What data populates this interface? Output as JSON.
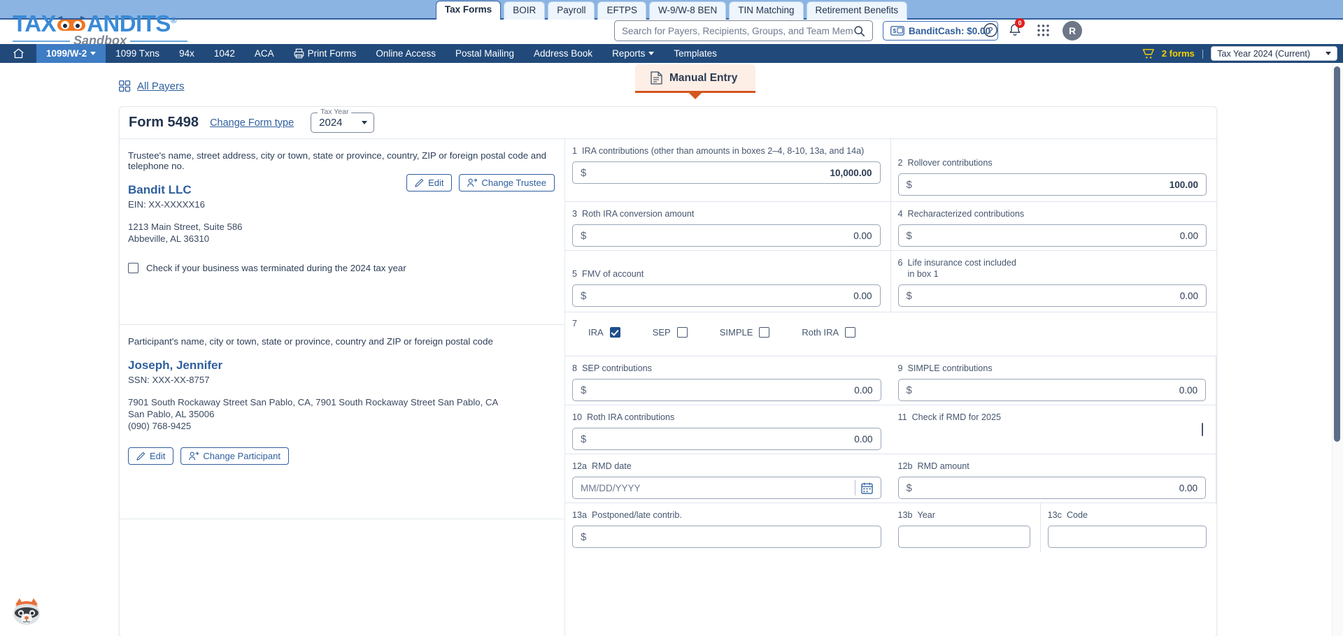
{
  "product_tabs": [
    {
      "label": "Tax Forms",
      "active": true
    },
    {
      "label": "BOIR",
      "active": false
    },
    {
      "label": "Payroll",
      "active": false
    },
    {
      "label": "EFTPS",
      "active": false
    },
    {
      "label": "W-9/W-8 BEN",
      "active": false
    },
    {
      "label": "TIN Matching",
      "active": false
    },
    {
      "label": "Retirement Benefits",
      "active": false
    }
  ],
  "brand": {
    "name_part1": "TAX",
    "name_part2": "ANDITS",
    "registered": "®",
    "subtitle": "Sandbox"
  },
  "search": {
    "placeholder": "Search for Payers, Recipients, Groups, and Team Members",
    "value": "",
    "icon": "search-icon"
  },
  "header": {
    "banditcash_label": "BanditCash: $0.00",
    "banditcash_icon": "cash-card-icon",
    "help_icon": "help-circle-icon",
    "bell_icon": "bell-icon",
    "notification_count": "0",
    "apps_icon": "apps-grid-icon",
    "avatar_initial": "R"
  },
  "nav": {
    "home_icon": "home-icon",
    "items": [
      {
        "label": "1099/W-2",
        "active": true,
        "caret": true
      },
      {
        "label": "1099 Txns",
        "active": false,
        "caret": false
      },
      {
        "label": "94x",
        "active": false,
        "caret": false
      },
      {
        "label": "1042",
        "active": false,
        "caret": false
      },
      {
        "label": "ACA",
        "active": false,
        "caret": false
      },
      {
        "label": "Print Forms",
        "active": false,
        "caret": false,
        "icon": "printer-icon"
      },
      {
        "label": "Online Access",
        "active": false,
        "caret": false
      },
      {
        "label": "Postal Mailing",
        "active": false,
        "caret": false
      },
      {
        "label": "Address Book",
        "active": false,
        "caret": false
      },
      {
        "label": "Reports",
        "active": false,
        "caret": true
      },
      {
        "label": "Templates",
        "active": false,
        "caret": false
      }
    ],
    "cart_icon": "cart-icon",
    "forms_count_label": "2 forms",
    "separator": "|",
    "tax_year_selected": "Tax Year 2024 (Current)"
  },
  "breadcrumb": {
    "all_payers_label": "All Payers",
    "grid_icon": "grid-squares-icon"
  },
  "entry_tab": {
    "label": "Manual Entry",
    "icon": "document-icon"
  },
  "form": {
    "title": "Form 5498",
    "change_form_link": "Change Form type",
    "tax_year_legend": "Tax Year",
    "tax_year_value": "2024"
  },
  "trustee": {
    "caption": "Trustee's name, street address, city or town, state or province, country, ZIP or foreign postal code and telephone no.",
    "name": "Bandit LLC",
    "ein": "EIN: XX-XXXXX16",
    "address_line1": "1213 Main Street, Suite 586",
    "address_line2": "Abbeville, AL 36310",
    "edit_label": "Edit",
    "edit_icon": "pencil-icon",
    "change_label": "Change Trustee",
    "change_icon": "user-switch-icon",
    "terminated_checkbox_label": "Check if your business was terminated during the 2024 tax year",
    "terminated_checked": false
  },
  "participant": {
    "caption": "Participant's name, city or town, state or province, country and ZIP or foreign postal code",
    "name": "Joseph, Jennifer",
    "ssn": "SSN: XXX-XX-8757",
    "address_line1": "7901 South Rockaway Street San Pablo, CA, 7901 South Rockaway Street San Pablo, CA",
    "address_line2": "San Pablo, AL 35006",
    "phone": "(090) 768-9425",
    "edit_label": "Edit",
    "edit_icon": "pencil-icon",
    "change_label": "Change Participant",
    "change_icon": "user-switch-icon"
  },
  "boxes": {
    "b1": {
      "num": "1",
      "label": "IRA contributions (other than amounts in boxes 2–4, 8-10, 13a, and 14a)",
      "currency": "$",
      "value": "10,000.00"
    },
    "b2": {
      "num": "2",
      "label": "Rollover contributions",
      "currency": "$",
      "value": "100.00"
    },
    "b3": {
      "num": "3",
      "label": "Roth IRA conversion amount",
      "currency": "$",
      "value": "0.00"
    },
    "b4": {
      "num": "4",
      "label": "Recharacterized contributions",
      "currency": "$",
      "value": "0.00"
    },
    "b5": {
      "num": "5",
      "label": "FMV of account",
      "currency": "$",
      "value": "0.00"
    },
    "b6": {
      "num": "6",
      "label": "Life insurance cost included in box 1",
      "currency": "$",
      "value": "0.00"
    },
    "b7": {
      "num": "7",
      "options": [
        {
          "label": "IRA",
          "checked": true
        },
        {
          "label": "SEP",
          "checked": false
        },
        {
          "label": "SIMPLE",
          "checked": false
        },
        {
          "label": "Roth IRA",
          "checked": false
        }
      ]
    },
    "b8": {
      "num": "8",
      "label": "SEP contributions",
      "currency": "$",
      "value": "0.00"
    },
    "b9": {
      "num": "9",
      "label": "SIMPLE contributions",
      "currency": "$",
      "value": "0.00"
    },
    "b10": {
      "num": "10",
      "label": "Roth IRA contributions",
      "currency": "$",
      "value": "0.00"
    },
    "b11": {
      "num": "11",
      "label": "Check if RMD for 2025",
      "checked": false
    },
    "b12a": {
      "num": "12a",
      "label": "RMD date",
      "placeholder": "MM/DD/YYYY",
      "value": "",
      "icon": "calendar-icon"
    },
    "b12b": {
      "num": "12b",
      "label": "RMD amount",
      "currency": "$",
      "value": "0.00"
    },
    "b13a": {
      "num": "13a",
      "label": "Postponed/late contrib.",
      "currency": "$",
      "value": ""
    },
    "b13b": {
      "num": "13b",
      "label": "Year",
      "value": ""
    },
    "b13c": {
      "num": "13c",
      "label": "Code",
      "value": ""
    }
  },
  "mascot": {
    "name": "bandit-raccoon-mascot"
  }
}
